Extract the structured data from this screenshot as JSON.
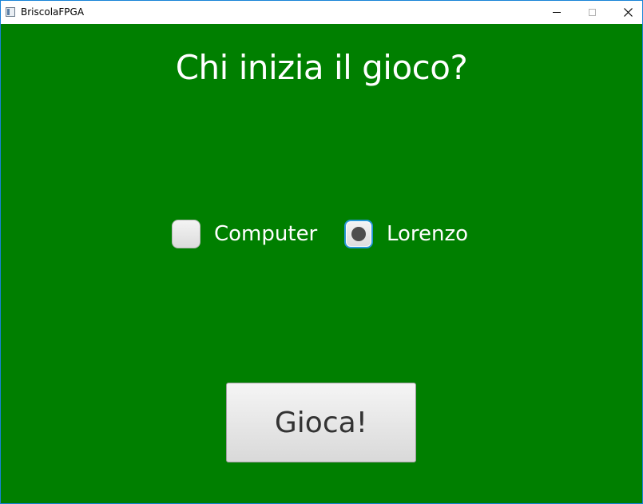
{
  "window": {
    "title": "BriscolaFPGA",
    "icon": "java-app-icon"
  },
  "controls": {
    "minimize": "minimize-icon",
    "maximize": "maximize-icon",
    "close": "close-icon",
    "close_glyph": "✕"
  },
  "main": {
    "heading": "Chi inizia il gioco?",
    "options": [
      {
        "label": "Computer",
        "selected": false
      },
      {
        "label": "Lorenzo",
        "selected": true
      }
    ],
    "play_button_label": "Gioca!"
  },
  "colors": {
    "background": "#007f00",
    "text": "#ffffff",
    "focus_ring": "#2a97d6"
  }
}
